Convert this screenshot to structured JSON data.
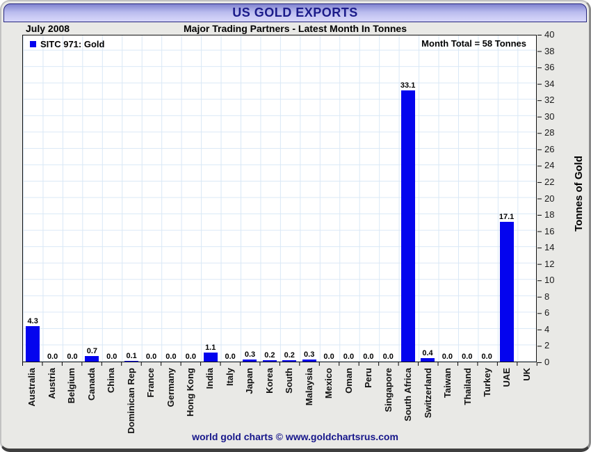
{
  "header": {
    "title": "US GOLD EXPORTS"
  },
  "subheader": {
    "date": "July 2008",
    "title": "Major Trading Partners - Latest Month In Tonnes"
  },
  "legend": {
    "label": "SITC 971: Gold",
    "swatch_color": "#0404ee"
  },
  "annotations": {
    "month_total": "Month Total = 58 Tonnes"
  },
  "y_axis": {
    "title": "Tonnes of Gold",
    "min": 0,
    "max": 40,
    "tick_step": 2
  },
  "footer": {
    "text": "world gold charts © www.goldchartsrus.com"
  },
  "colors": {
    "bar": "#0404ee",
    "grid": "#d9e8f6",
    "title_text": "#1b1b8a",
    "footer_text": "#16168a",
    "header_gradient_top": "#8083cf",
    "header_gradient_bottom": "#d6d6fa",
    "frame_background": "#e9e9e6",
    "plot_background": "#ffffff"
  },
  "chart_data": {
    "type": "bar",
    "title": "US GOLD EXPORTS",
    "subtitle": "Major Trading Partners - Latest Month In Tonnes",
    "period": "July 2008",
    "series_name": "SITC 971: Gold",
    "categories": [
      "Australia",
      "Austria",
      "Belgium",
      "Canada",
      "China",
      "Dominican Rep",
      "France",
      "Germany",
      "Hong Kong",
      "India",
      "Italy",
      "Japan",
      "Korea",
      "South",
      "Malaysia",
      "Mexico",
      "Oman",
      "Peru",
      "Singapore",
      "South Africa",
      "Switzerland",
      "Taiwan",
      "Thailand",
      "Turkey",
      "UAE",
      "UK"
    ],
    "values": [
      4.3,
      0.0,
      0.0,
      0.7,
      0.0,
      0.1,
      0.0,
      0.0,
      0.0,
      1.1,
      0.0,
      0.3,
      0.2,
      0.2,
      0.3,
      0.0,
      0.0,
      0.0,
      0.0,
      33.1,
      0.4,
      0.0,
      0.0,
      0.0,
      17.1,
      null
    ],
    "value_labels": [
      "4.3",
      "0.0",
      "0.0",
      "0.7",
      "0.0",
      "0.1",
      "0.0",
      "0.0",
      "0.0",
      "1.1",
      "0.0",
      "0.3",
      "0.2",
      "0.2",
      "0.3",
      "0.0",
      "0.0",
      "0.0",
      "0.0",
      "33.1",
      "0.4",
      "0.0",
      "0.0",
      "0.0",
      "17.1",
      ""
    ],
    "xlabel": "",
    "ylabel": "Tonnes of Gold",
    "ylim": [
      0,
      40
    ],
    "y_tick_step": 2,
    "grid": true,
    "legend_position": "top-left",
    "annotation": "Month Total = 58 Tonnes",
    "month_total_tonnes": 58
  }
}
